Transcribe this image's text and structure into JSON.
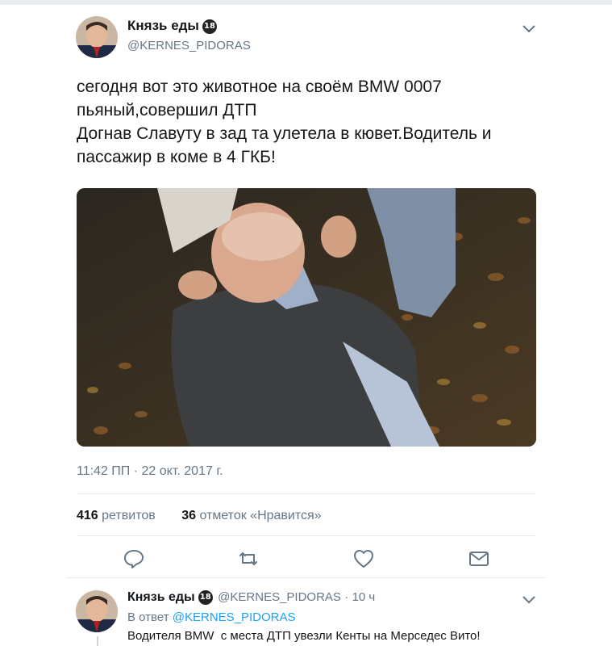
{
  "tweet": {
    "author_name": "Князь еды",
    "badge": "18",
    "author_handle": "@KERNES_PIDORAS",
    "text_lines": [
      "сегодня вот это животное на своём BMW 0007",
      "пьяный,совершил ДТП",
      "Догнав Славуту в зад та улетела в кювет.Водитель и",
      "пассажир в коме в 4 ГКБ!"
    ],
    "timestamp": "11:42 ПП · 22 окт. 2017 г.",
    "retweets_count": "416",
    "retweets_label": "ретвитов",
    "likes_count": "36",
    "likes_label": "отметок «Нравится»"
  },
  "reply": {
    "author_name": "Князь еды",
    "badge": "18",
    "author_handle": "@KERNES_PIDORAS",
    "time": "· 10 ч",
    "reply_to_prefix": "В ответ",
    "reply_to_handle": "@KERNES_PIDORAS",
    "text": "Водителя BMW  с места ДТП увезли Кенты на Мерседес Вито!"
  },
  "icons": {
    "menu": "chevron-down-icon",
    "reply": "reply-icon",
    "retweet": "retweet-icon",
    "like": "heart-icon",
    "share": "envelope-icon"
  },
  "colors": {
    "text": "#14171a",
    "secondary": "#657786",
    "link": "#1da1f2",
    "divider": "#e6ecf0"
  }
}
